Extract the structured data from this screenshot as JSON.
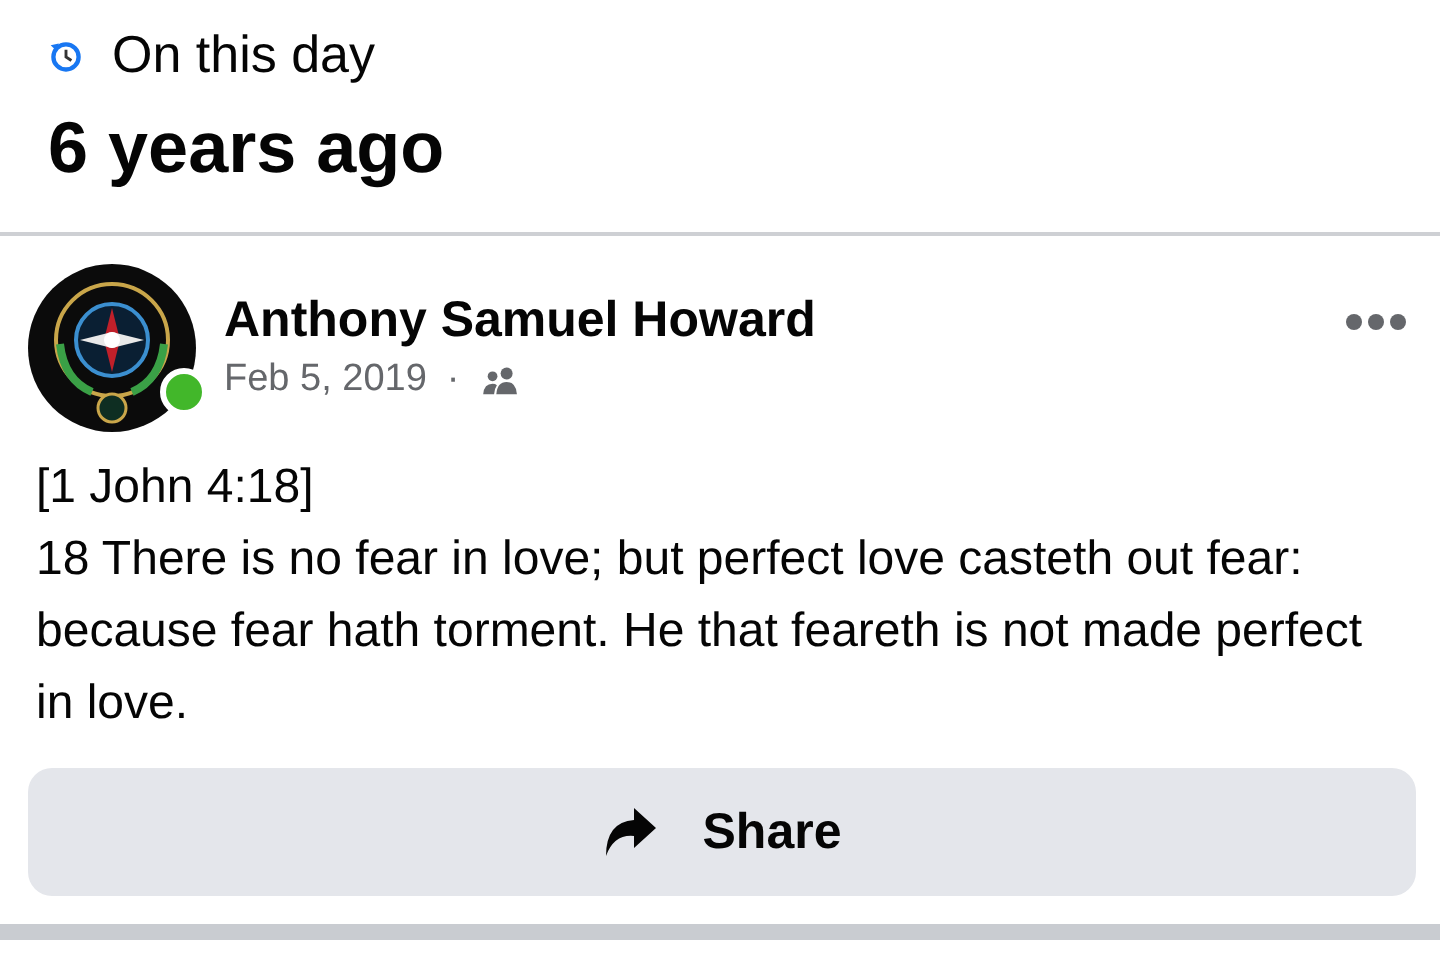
{
  "memory": {
    "label": "On this day",
    "title": "6 years ago"
  },
  "post": {
    "author": "Anthony Samuel Howard",
    "online": true,
    "date": "Feb 5, 2019",
    "separator": "·",
    "lines": [
      "[1 John 4:18]",
      "18 There is no fear in love; but perfect love casteth out fear: because fear hath torment. He that feareth is not made perfect in love."
    ],
    "actions": [
      {
        "label": "Share"
      }
    ]
  }
}
